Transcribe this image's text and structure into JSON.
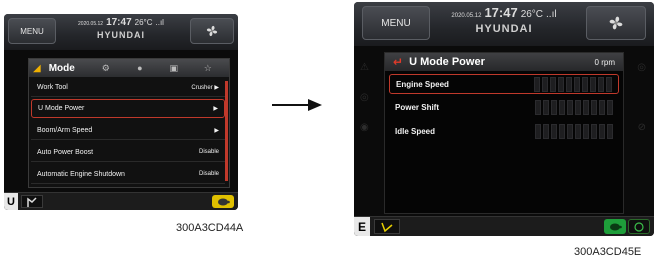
{
  "screen1": {
    "topbar": {
      "menu_label": "MENU",
      "date": "2020.05.12",
      "time": "17:47",
      "temp": "26°C",
      "signal": "..ıl",
      "brand": "HYUNDAI",
      "fan_icon": "fan-icon"
    },
    "popup": {
      "mode_label": "Mode",
      "items": [
        {
          "label": "Work Tool",
          "value": "Crusher ▶",
          "selected": false
        },
        {
          "label": "U Mode Power",
          "value": "▶",
          "selected": true
        },
        {
          "label": "Boom/Arm Speed",
          "value": "▶",
          "selected": false
        },
        {
          "label": "Auto Power Boost",
          "value": "Disable",
          "selected": false
        },
        {
          "label": "Automatic Engine Shutdown",
          "value": "Disable",
          "selected": false
        }
      ]
    },
    "bottombar": {
      "mode_letter": "U"
    },
    "caption": "300A3CD44A"
  },
  "screen2": {
    "topbar": {
      "menu_label": "MENU",
      "date": "2020.05.12",
      "time": "17:47",
      "temp": "26°C",
      "signal": "..ıl",
      "brand": "HYUNDAI",
      "fan_icon": "fan-icon"
    },
    "panel": {
      "title": "U Mode Power",
      "rpm": "0 rpm",
      "rows": [
        {
          "label": "Engine Speed",
          "selected": true
        },
        {
          "label": "Power Shift",
          "selected": false
        },
        {
          "label": "Idle Speed",
          "selected": false
        }
      ]
    },
    "bottombar": {
      "mode_letter": "E"
    },
    "caption": "300A3CD45E"
  },
  "colors": {
    "accent_red": "#c0392b",
    "mode_yellow": "#f0b000",
    "turtle_green": "#1e9e3a"
  }
}
